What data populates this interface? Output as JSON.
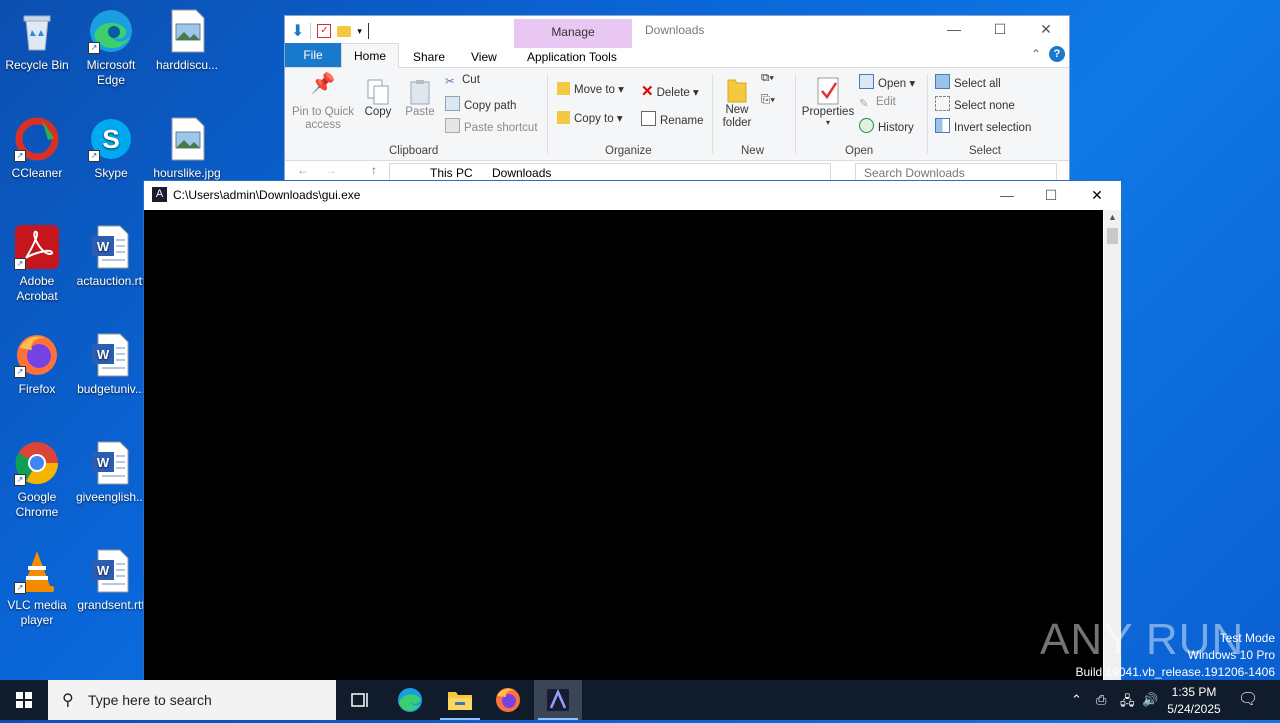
{
  "desktop": {
    "icons": [
      {
        "label": "Recycle Bin",
        "icon": "recycle-bin-icon"
      },
      {
        "label": "Microsoft Edge",
        "icon": "edge-icon"
      },
      {
        "label": "harddiscu...",
        "icon": "image-file-icon"
      },
      {
        "label": "CCleaner",
        "icon": "ccleaner-icon"
      },
      {
        "label": "Skype",
        "icon": "skype-icon"
      },
      {
        "label": "hourslike.jpg",
        "icon": "image-file-icon"
      },
      {
        "label": "Adobe Acrobat",
        "icon": "acrobat-icon"
      },
      {
        "label": "actauction.rtf",
        "icon": "word-doc-icon"
      },
      {
        "label": "Firefox",
        "icon": "firefox-icon"
      },
      {
        "label": "budgetuniv...",
        "icon": "word-doc-icon"
      },
      {
        "label": "Google Chrome",
        "icon": "chrome-icon"
      },
      {
        "label": "giveenglish...",
        "icon": "word-doc-icon"
      },
      {
        "label": "VLC media player",
        "icon": "vlc-icon"
      },
      {
        "label": "grandsent.rtf",
        "icon": "word-doc-icon"
      }
    ]
  },
  "explorer": {
    "title": "Downloads",
    "manage_tab": "Manage",
    "tabs": [
      "File",
      "Home",
      "Share",
      "View",
      "Application Tools"
    ],
    "clipboard": {
      "pin": "Pin to Quick access",
      "copy": "Copy",
      "paste": "Paste",
      "cut": "Cut",
      "copy_path": "Copy path",
      "paste_shortcut": "Paste shortcut",
      "label": "Clipboard"
    },
    "organize": {
      "move_to": "Move to",
      "copy_to": "Copy to",
      "delete": "Delete",
      "rename": "Rename",
      "label": "Organize"
    },
    "new": {
      "new_folder": "New folder",
      "label": "New"
    },
    "open": {
      "properties": "Properties",
      "open": "Open",
      "edit": "Edit",
      "history": "History",
      "label": "Open"
    },
    "select": {
      "select_all": "Select all",
      "select_none": "Select none",
      "invert": "Invert selection",
      "label": "Select"
    },
    "address": {
      "this_pc": "This PC",
      "downloads": "Downloads"
    },
    "search_placeholder": "Search Downloads"
  },
  "console": {
    "title": "C:\\Users\\admin\\Downloads\\gui.exe"
  },
  "taskbar": {
    "search_placeholder": "Type here to search",
    "time": "1:35 PM",
    "date": "5/24/2025"
  },
  "watermark": {
    "line1": "Test Mode",
    "line2": "Windows 10 Pro",
    "line3": "Build 19041.vb_release.191206-1406",
    "brand": "ANY RUN"
  },
  "colors": {
    "desktop": "#0a66d8",
    "accent": "#1979ca",
    "taskbar": "#101c2c",
    "manage": "#e8c8f2"
  }
}
